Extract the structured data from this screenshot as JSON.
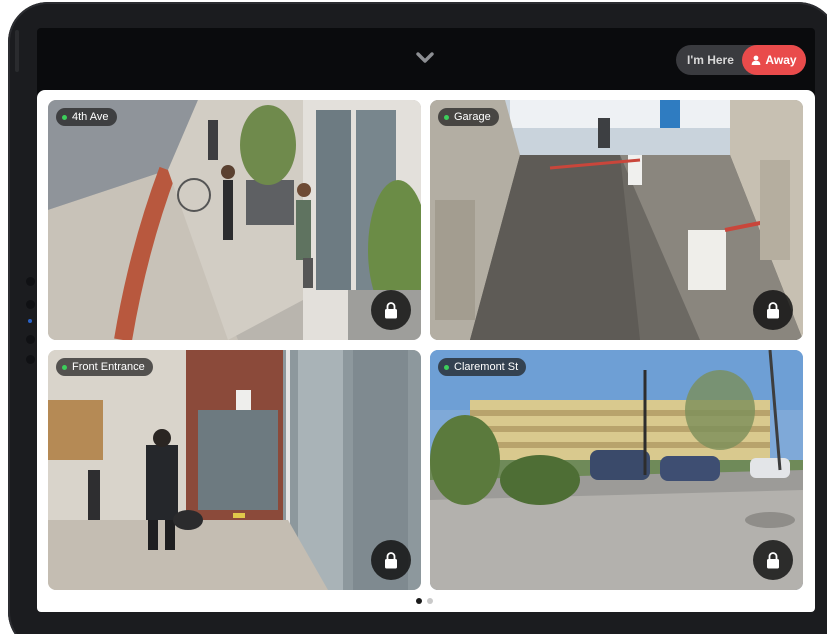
{
  "presence": {
    "here_label": "I'm Here",
    "away_label": "Away",
    "active": "away"
  },
  "colors": {
    "away_accent": "#e94b4b",
    "live_indicator": "#3ccf5b",
    "page_dot_active": "#1a1a1a",
    "page_dot_inactive": "#c9c9c9"
  },
  "cameras": [
    {
      "label": "4th Ave"
    },
    {
      "label": "Garage"
    },
    {
      "label": "Front Entrance"
    },
    {
      "label": "Claremont St"
    }
  ],
  "icons": {
    "top_chevron": "chevron-down-icon",
    "lock": "lock-icon",
    "person": "person-icon"
  },
  "pagination": {
    "total": 2,
    "current": 1
  }
}
